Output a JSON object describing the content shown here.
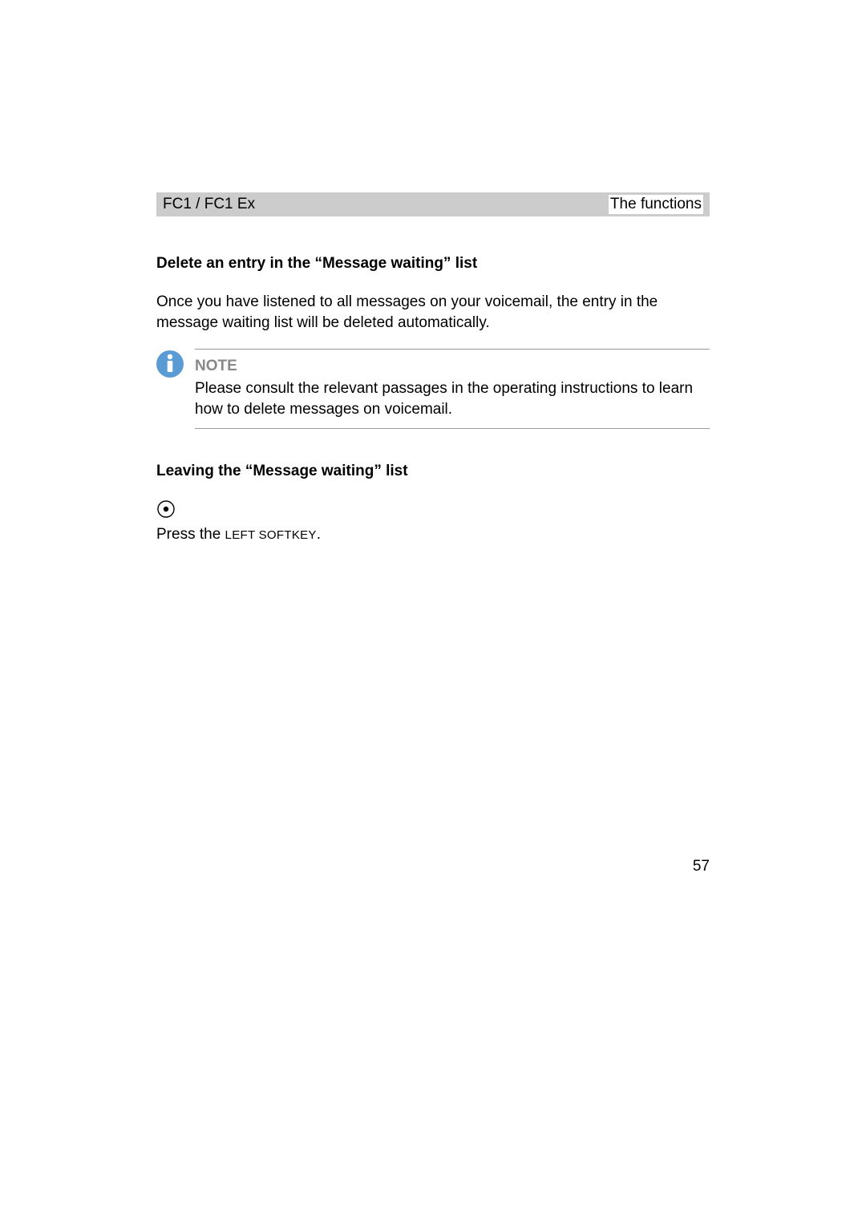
{
  "header": {
    "left": "FC1 / FC1 Ex",
    "right": "The functions"
  },
  "section1": {
    "heading": "Delete an entry in the “Message waiting” list",
    "body": "Once you have listened to all messages on your voicemail, the entry in the message waiting list will be deleted automatically."
  },
  "note": {
    "label": "NOTE",
    "text": "Please consult the relevant passages in the operating instructions to learn how to delete messages on voicemail."
  },
  "section2": {
    "heading": "Leaving the “Message waiting” list",
    "line_prefix": "Press the ",
    "line_smallcaps": "LEFT SOFTKEY",
    "line_suffix": "."
  },
  "page_number": "57"
}
